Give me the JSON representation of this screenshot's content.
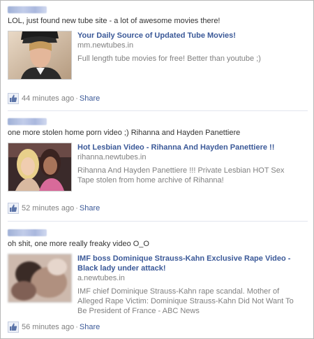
{
  "posts": [
    {
      "message": "LOL, just found new tube site - a lot of awesome movies there!",
      "title": "Your Daily Source of Updated Tube Movies!",
      "domain": "mm.newtubes.in",
      "description": "Full length tube movies for free! Better than youtube ;)",
      "time": "44 minutes ago",
      "share": "Share"
    },
    {
      "message": "one more stolen home porn video ;) Rihanna and Hayden Panettiere",
      "title": "Hot Lesbian Video - Rihanna And Hayden Panettiere !!",
      "domain": "rihanna.newtubes.in",
      "description": "Rihanna And Hayden Panettiere !!! Private Lesbian HOT Sex Tape stolen from home archive of Rihanna!",
      "time": "52 minutes ago",
      "share": "Share"
    },
    {
      "message": "oh shit, one more really freaky video O_O",
      "title": "IMF boss Dominique Strauss-Kahn Exclusive Rape Video - Black lady under attack!",
      "domain": "a.newtubes.in",
      "description": "IMF chief Dominique Strauss-Kahn rape scandal. Mother of Alleged Rape Victim: Dominique Strauss-Kahn Did Not Want To Be President of France - ABC News",
      "time": "56 minutes ago",
      "share": "Share"
    }
  ],
  "separator": "·",
  "icons": {
    "like": "thumbs-up-icon"
  }
}
